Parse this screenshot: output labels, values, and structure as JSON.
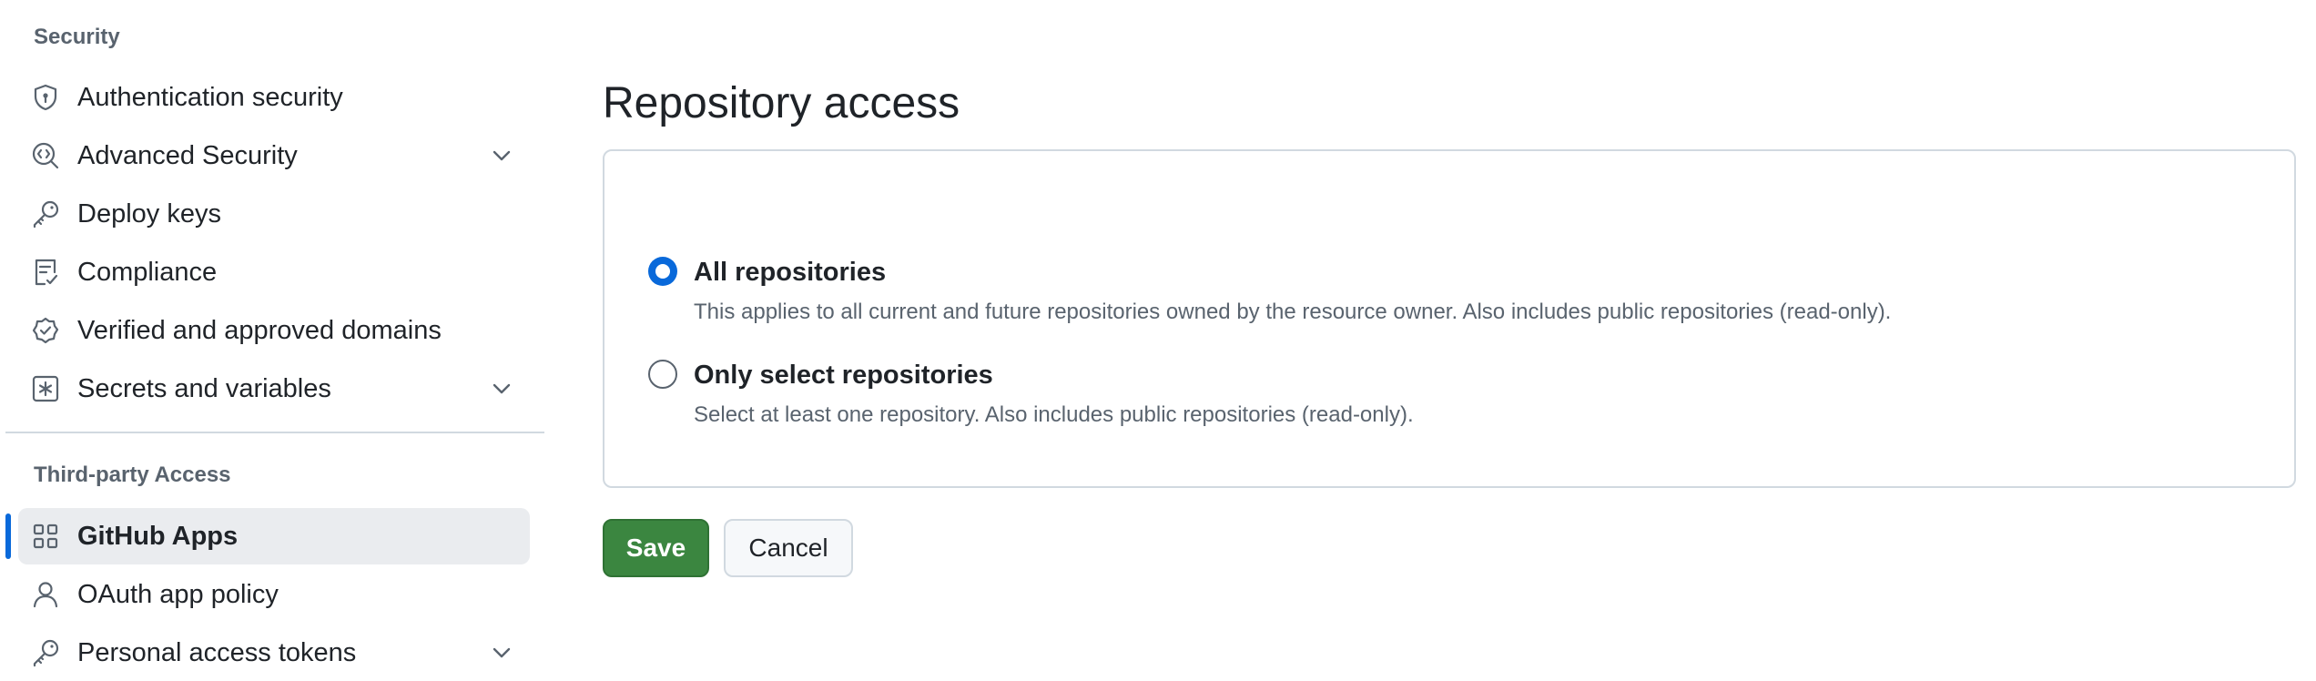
{
  "sidebar": {
    "security_heading": "Security",
    "security_items": [
      {
        "label": "Authentication security",
        "icon": "shield-lock-icon",
        "expandable": false
      },
      {
        "label": "Advanced Security",
        "icon": "codescan-icon",
        "expandable": true
      },
      {
        "label": "Deploy keys",
        "icon": "key-icon",
        "expandable": false
      },
      {
        "label": "Compliance",
        "icon": "checklist-icon",
        "expandable": false
      },
      {
        "label": "Verified and approved domains",
        "icon": "verified-icon",
        "expandable": false
      },
      {
        "label": "Secrets and variables",
        "icon": "asterisk-icon",
        "expandable": true
      }
    ],
    "third_party_heading": "Third-party Access",
    "third_party_items": [
      {
        "label": "GitHub Apps",
        "icon": "apps-icon",
        "expandable": false,
        "selected": true
      },
      {
        "label": "OAuth app policy",
        "icon": "person-icon",
        "expandable": false
      },
      {
        "label": "Personal access tokens",
        "icon": "key-icon",
        "expandable": true
      }
    ]
  },
  "main": {
    "title": "Repository access",
    "options": [
      {
        "label": "All repositories",
        "description": "This applies to all current and future repositories owned by the resource owner. Also includes public repositories (read-only).",
        "checked": true
      },
      {
        "label": "Only select repositories",
        "description": "Select at least one repository. Also includes public repositories (read-only).",
        "checked": false
      }
    ],
    "save_label": "Save",
    "cancel_label": "Cancel"
  },
  "colors": {
    "accent": "#0969da",
    "save_button": "#3b8640",
    "muted_text": "#59636e"
  }
}
